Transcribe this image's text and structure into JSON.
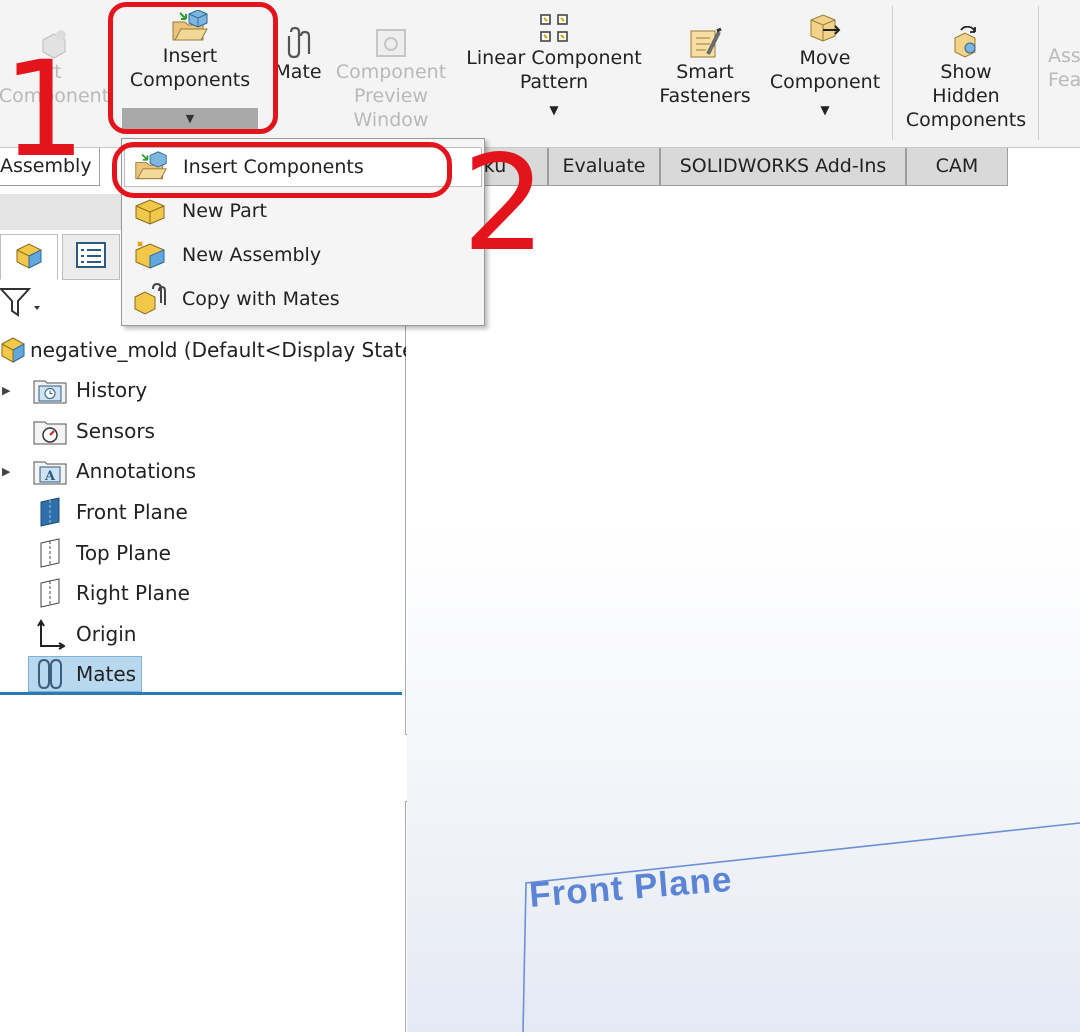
{
  "ribbon": {
    "partial_left_label": "rt\nComponent",
    "insert_components": "Insert\nComponents",
    "mate": "Mate",
    "component_preview": "Component\nPreview\nWindow",
    "linear_pattern": "Linear Component\nPattern",
    "smart_fasteners": "Smart\nFasteners",
    "move_component": "Move\nComponent",
    "show_hidden": "Show\nHidden\nComponents",
    "partial_right_label": "Ass\nFea",
    "dropdown_arrow": "▼"
  },
  "tabs": [
    {
      "label": "Assembly"
    },
    {
      "label": "rku"
    },
    {
      "label": "Evaluate"
    },
    {
      "label": "SOLIDWORKS Add-Ins"
    },
    {
      "label": "CAM"
    }
  ],
  "dropdown": {
    "items": [
      {
        "label": "Insert Components"
      },
      {
        "label": "New Part"
      },
      {
        "label": "New Assembly"
      },
      {
        "label": "Copy with Mates"
      }
    ]
  },
  "tree": {
    "root": "negative_mold  (Default<Display State",
    "items": [
      {
        "label": "History",
        "icon": "history-folder-icon"
      },
      {
        "label": "Sensors",
        "icon": "sensors-folder-icon"
      },
      {
        "label": "Annotations",
        "icon": "annotations-folder-icon"
      },
      {
        "label": "Front Plane",
        "icon": "plane-icon"
      },
      {
        "label": "Top Plane",
        "icon": "plane-icon"
      },
      {
        "label": "Right Plane",
        "icon": "plane-icon"
      },
      {
        "label": "Origin",
        "icon": "origin-icon"
      },
      {
        "label": "Mates",
        "icon": "mates-icon"
      }
    ]
  },
  "graphics": {
    "plane_label": "Front Plane"
  },
  "annotations": {
    "step1": "1",
    "step2": "2",
    "color": "#e3141b"
  },
  "colors": {
    "selection": "#b7d8ef",
    "plane": "#5b84d6",
    "divider": "#2a7ab3"
  }
}
